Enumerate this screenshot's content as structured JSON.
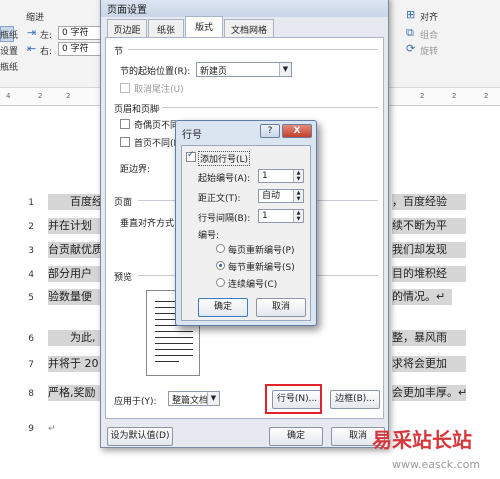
{
  "ribbon": {
    "indent_label": "缩进",
    "left_label": "左:",
    "left_value": "0 字符",
    "right_label": "右:",
    "right_value": "0 字符",
    "left_group_top": "瓶纸",
    "left_group_mid": "设置",
    "left_group_bot": "瓶纸",
    "align_label": "对齐",
    "group_label": "组合",
    "rotate_label": "旋转"
  },
  "ruler": {
    "numbers": [
      "4",
      "2",
      "2",
      "2",
      "2",
      "2"
    ]
  },
  "document": {
    "line_numbers": [
      "1",
      "2",
      "3",
      "4",
      "5",
      "6",
      "7",
      "8",
      "9"
    ],
    "left_fragments": [
      "百度经",
      "并在计划",
      "台贡献优质",
      "部分用户",
      "验数量便",
      "为此,",
      "并将于 20",
      "严格,奖励",
      ""
    ],
    "right_fragments": [
      "，百度经验",
      "续不断为平",
      "我们却发现",
      "目的堆积经",
      "的情况。↵",
      "整，暴风雨",
      "求将会更加",
      "会更加丰厚。↵",
      ""
    ],
    "para_mark": "↵"
  },
  "page_setup": {
    "title": "页面设置",
    "tabs": [
      "页边距",
      "纸张",
      "版式",
      "文档网格"
    ],
    "active_tab": "版式",
    "section_heading": "节",
    "section_start_label": "节的起始位置(R):",
    "section_start_value": "新建页",
    "suppress_endnotes": "取消尾注(U)",
    "headers_heading": "页眉和页脚",
    "odd_even": "奇偶页不同",
    "first_page": "首页不同(P",
    "from_edge": "距边界:",
    "page_heading": "页面",
    "vertical_align": "垂直对齐方式",
    "preview_heading": "预览",
    "apply_to_label": "应用于(Y):",
    "apply_to_value": "整篇文档",
    "line_numbers_button": "行号(N)...",
    "borders_button": "边框(B)...",
    "set_default_button": "设为默认值(D)",
    "ok_button": "确定",
    "cancel_button": "取消"
  },
  "line_numbers_dialog": {
    "title": "行号",
    "help": "?",
    "close": "X",
    "add_line_numbers": "添加行号(L)",
    "start_at_label": "起始编号(A):",
    "start_at_value": "1",
    "from_text_label": "距正文(T):",
    "from_text_value": "自动",
    "count_by_label": "行号间隔(B):",
    "count_by_value": "1",
    "numbering_label": "编号:",
    "restart_page": "每页重新编号(P)",
    "restart_section": "每节重新编号(S)",
    "continuous": "连续编号(C)",
    "ok": "确定",
    "cancel": "取消"
  },
  "watermark": {
    "brand": "易采站长站",
    "url": "www.easck.com"
  }
}
